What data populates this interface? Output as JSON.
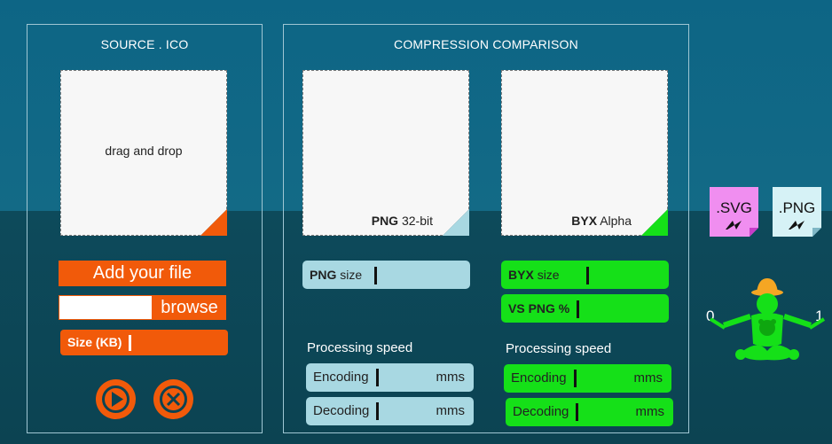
{
  "source_panel": {
    "title": "SOURCE . ICO",
    "drop_zone_text": "drag and drop",
    "add_file_label": "Add your file",
    "browse_label": "browse",
    "size_label": "Size (KB)"
  },
  "comparison_panel": {
    "title": "COMPRESSION COMPARISON",
    "png_preview": {
      "format": "PNG",
      "detail": "32-bit"
    },
    "byx_preview": {
      "format": "BYX",
      "detail": "Alpha"
    },
    "png_size": {
      "label_bold": "PNG",
      "label_rest": "size"
    },
    "byx_size": {
      "label_bold": "BYX",
      "label_rest": "size"
    },
    "vs_png": {
      "label": "VS PNG",
      "unit": "%"
    },
    "png_speed": {
      "title": "Processing speed",
      "encoding_label": "Encoding",
      "encoding_unit": "mms",
      "decoding_label": "Decoding",
      "decoding_unit": "mms"
    },
    "byx_speed": {
      "title": "Processing speed",
      "encoding_label": "Encoding",
      "encoding_unit": "mms",
      "decoding_label": "Decoding",
      "decoding_unit": "mms"
    }
  },
  "export": {
    "svg_label": ".SVG",
    "png_label": ".PNG"
  },
  "scale": {
    "min_label": "0",
    "max_label": "1"
  },
  "colors": {
    "orange": "#f15a0a",
    "light_blue": "#a8d8e2",
    "green": "#15e018",
    "svg_pink": "#f08ef0",
    "png_lightblue": "#d6f2f6"
  }
}
